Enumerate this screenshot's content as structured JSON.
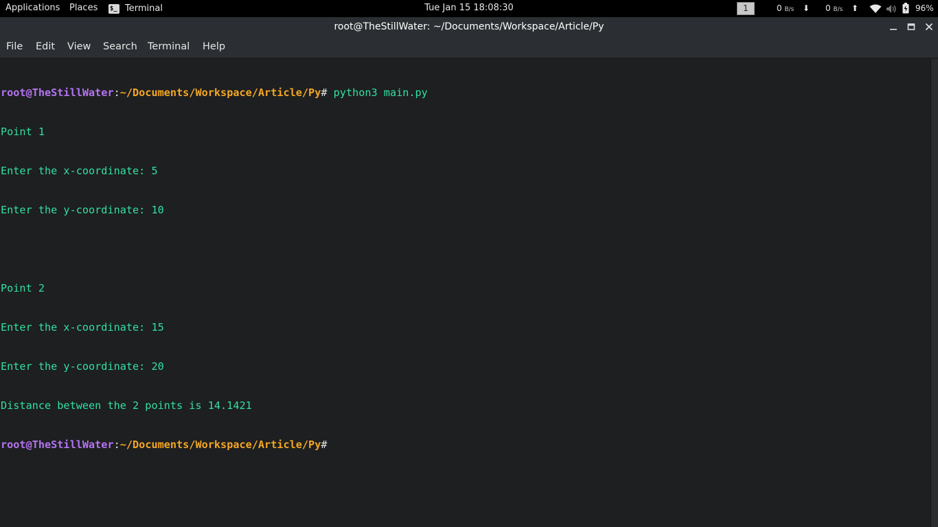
{
  "top_bar": {
    "applications": "Applications",
    "places": "Places",
    "terminal_app": "Terminal",
    "terminal_icon_glyph": "$_",
    "clock": "Tue Jan 15  18:08:30",
    "workspace": "1",
    "net_down_value": "0",
    "net_down_unit": "B/s",
    "net_up_value": "0",
    "net_up_unit": "B/s",
    "battery_percent": "96%"
  },
  "window": {
    "title": "root@TheStillWater: ~/Documents/Workspace/Article/Py"
  },
  "menu": {
    "file": "File",
    "edit": "Edit",
    "view": "View",
    "search": "Search",
    "terminal": "Terminal",
    "help": "Help"
  },
  "terminal": {
    "prompt_user": "root@TheStillWater",
    "prompt_colon": ":",
    "prompt_path": "~/Documents/Workspace/Article/Py",
    "prompt_hash": "#",
    "command": " python3 main.py",
    "output": [
      "Point 1",
      "Enter the x-coordinate: 5",
      "Enter the y-coordinate: 10",
      "",
      "Point 2",
      "Enter the x-coordinate: 15",
      "Enter the y-coordinate: 20",
      "Distance between the 2 points is 14.1421"
    ]
  },
  "icons": {
    "down": "download-arrow-icon",
    "up": "upload-arrow-icon",
    "wifi": "wifi-icon",
    "volume": "volume-muted-icon",
    "battery": "battery-charging-icon",
    "minimize": "minimize-icon",
    "maximize": "maximize-icon",
    "close": "close-icon"
  },
  "colors": {
    "prompt_user": "#b574f2",
    "prompt_path": "#f5a623",
    "output_text": "#33e0a0",
    "background": "#1d1f21"
  }
}
